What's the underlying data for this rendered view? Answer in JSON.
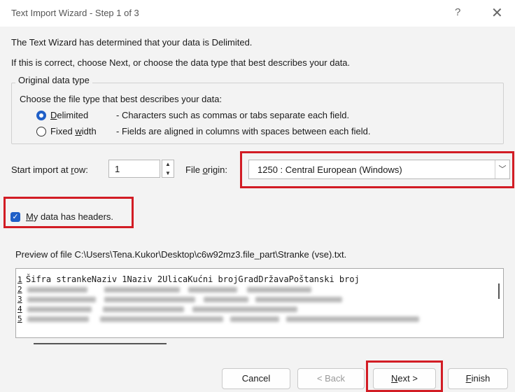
{
  "window": {
    "title": "Text Import Wizard - Step 1 of 3",
    "help_glyph": "?",
    "close_glyph": "✕"
  },
  "intro": {
    "line1": "The Text Wizard has determined that your data is Delimited.",
    "line2": "If this is correct, choose Next, or choose the data type that best describes your data."
  },
  "data_type": {
    "legend": "Original data type",
    "prompt": "Choose the file type that best describes your data:",
    "options": [
      {
        "label_pre": "",
        "label_key": "D",
        "label_post": "elimited",
        "desc": "- Characters such as commas or tabs separate each field.",
        "selected": true
      },
      {
        "label_pre": "Fixed ",
        "label_key": "w",
        "label_post": "idth",
        "desc": "- Fields are aligned in columns with spaces between each field.",
        "selected": false
      }
    ]
  },
  "import_row": {
    "label_pre": "Start import at ",
    "label_key": "r",
    "label_post": "ow:",
    "value": "1"
  },
  "file_origin": {
    "label_pre": "File ",
    "label_key": "o",
    "label_post": "rigin:",
    "value": "1250 : Central European (Windows)"
  },
  "headers": {
    "label_key": "M",
    "label_post": "y data has headers.",
    "checked": true
  },
  "preview": {
    "label": "Preview of file C:\\Users\\Tena.Kukor\\Desktop\\c6w92mz3.file_part\\Stranke (vse).txt.",
    "rows": [
      {
        "num": "1",
        "text": "Šifra strankeNaziv 1Naziv 2UlicaKućni brojGradDržavaPoštanski broj"
      },
      {
        "num": "2",
        "text": ""
      },
      {
        "num": "3",
        "text": ""
      },
      {
        "num": "4",
        "text": ""
      },
      {
        "num": "5",
        "text": ""
      }
    ]
  },
  "buttons": {
    "cancel": "Cancel",
    "back": "< Back",
    "next_key": "N",
    "next_post": "ext >",
    "finish_key": "F",
    "finish_post": "inish"
  },
  "colors": {
    "accent": "#1f5fc7",
    "highlight": "#d21c24",
    "dialog_bg": "#f3f3f3"
  }
}
